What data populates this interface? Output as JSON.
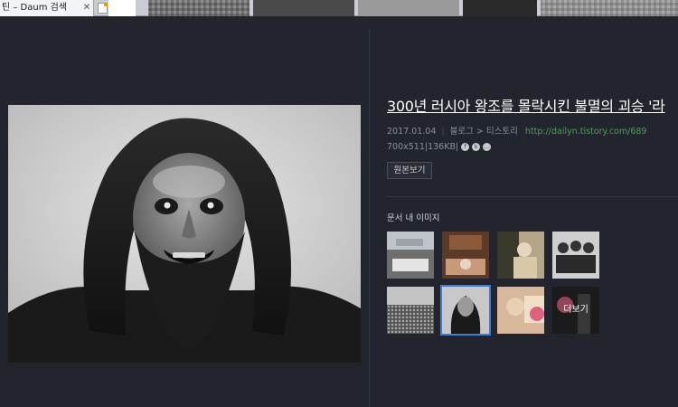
{
  "browser": {
    "tab_title": "틴 – Daum 검색",
    "close_glyph": "✕"
  },
  "viewer": {
    "title": "300년 러시아 왕조를 몰락시킨 불멸의 괴승 '라",
    "date": "2017.01.04",
    "source": "블로그 > 티스토리",
    "url": "http://dailyn.tistory.com/689",
    "dimensions": "700x511",
    "filesize": "136KB",
    "original_button": "원본보기",
    "section_title": "문서 내 이미지",
    "more_label": "더보기"
  },
  "colors": {
    "background": "#22252e",
    "link_green": "#47a24a",
    "selected_blue": "#3f7bd9"
  }
}
